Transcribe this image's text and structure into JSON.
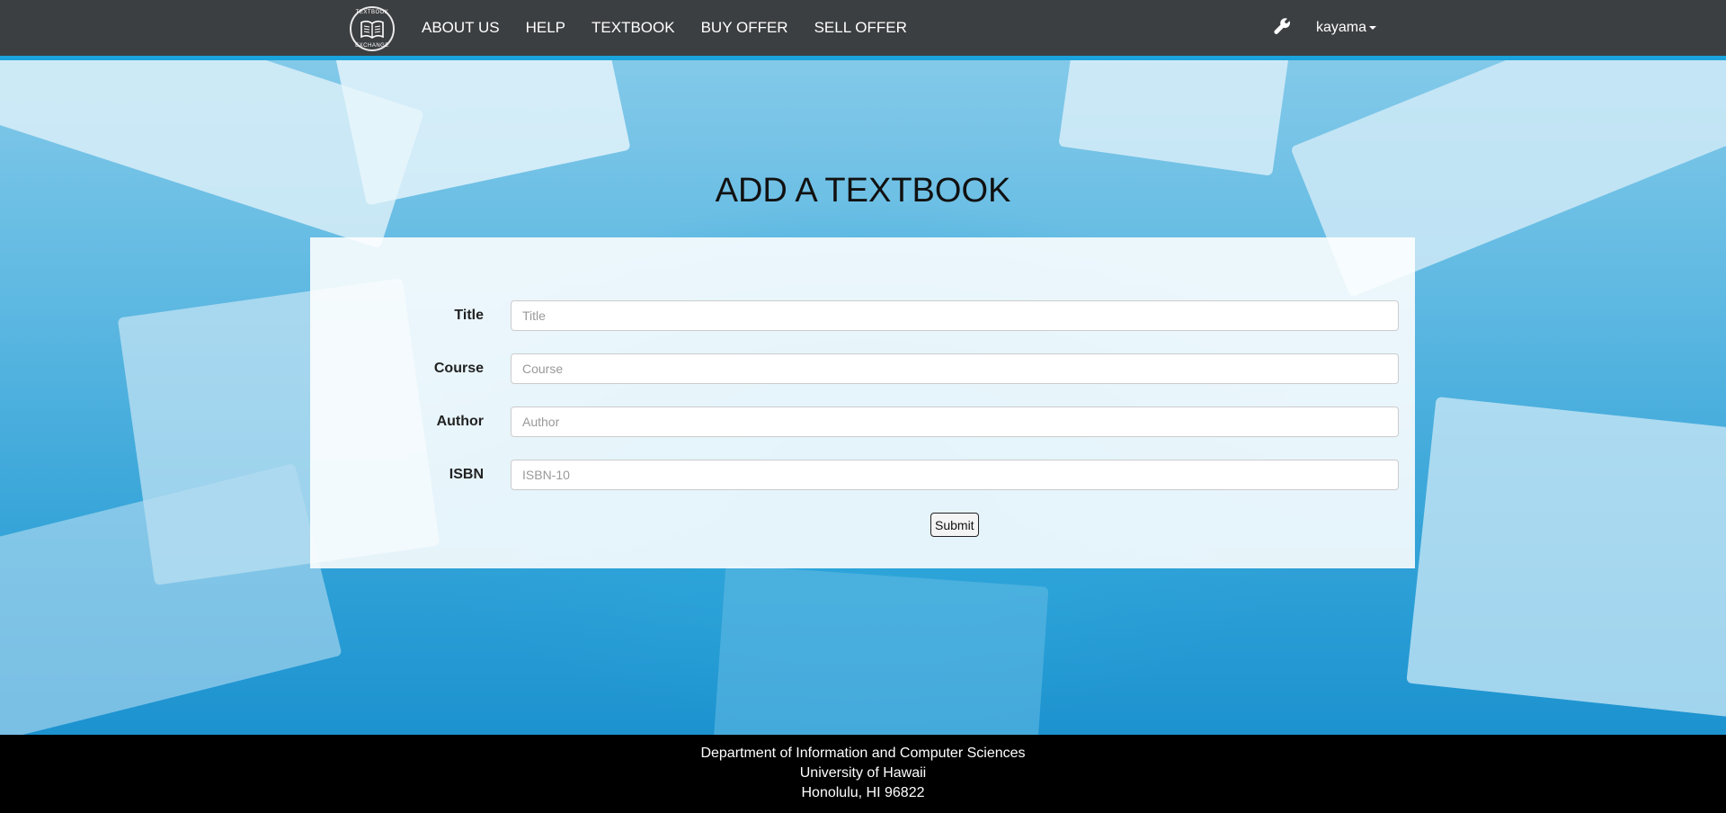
{
  "navbar": {
    "logo": {
      "icon": "book-icon",
      "ring_top": "TEXTBOOK",
      "ring_bottom": "EXCHANGE"
    },
    "links": [
      "ABOUT US",
      "HELP",
      "TEXTBOOK",
      "BUY OFFER",
      "SELL OFFER"
    ],
    "admin_icon": "wrench-icon",
    "user": "kayama",
    "accent_color": "#1aa3dc",
    "bg_color": "#3c3f42"
  },
  "page": {
    "title": "ADD A TEXTBOOK"
  },
  "form": {
    "fields": [
      {
        "label": "Title",
        "placeholder": "Title",
        "value": ""
      },
      {
        "label": "Course",
        "placeholder": "Course",
        "value": ""
      },
      {
        "label": "Author",
        "placeholder": "Author",
        "value": ""
      },
      {
        "label": "ISBN",
        "placeholder": "ISBN-10",
        "value": ""
      }
    ],
    "submit_label": "Submit"
  },
  "footer": {
    "line1": "Department of Information and Computer Sciences",
    "line2": "University of Hawaii",
    "line3": "Honolulu, HI 96822"
  }
}
